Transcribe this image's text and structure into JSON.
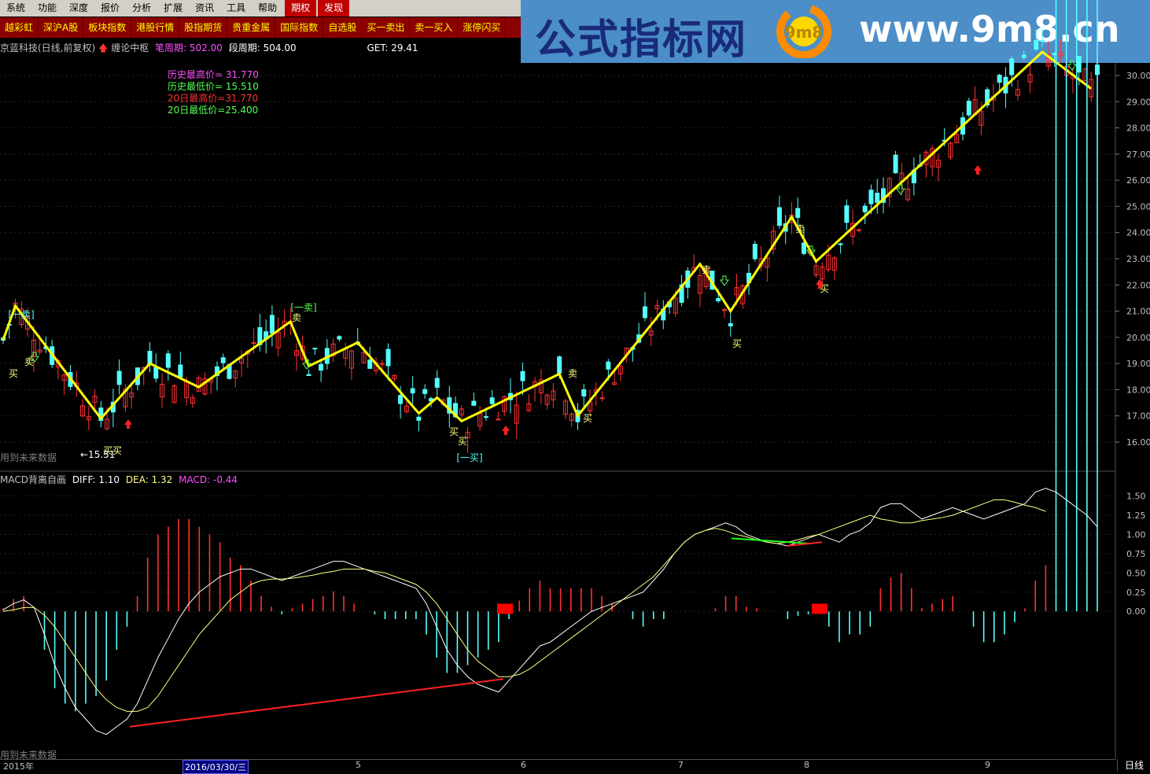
{
  "menubar": {
    "items": [
      "系统",
      "功能",
      "深度",
      "报价",
      "分析",
      "扩展",
      "资讯",
      "工具",
      "帮助"
    ],
    "highlighted": [
      "期权",
      "发现"
    ]
  },
  "quickbar": {
    "items": [
      "越彩虹",
      "深沪A股",
      "板块指数",
      "港股行情",
      "股指期货",
      "贵重金属",
      "国际指数",
      "自选股",
      "买一卖出",
      "卖一买入",
      "涨停闪买"
    ]
  },
  "banner": {
    "title": "公式指标网",
    "url": "www.9m8.cn",
    "logo_text": "9m8"
  },
  "header": {
    "stock": "京蓝科技(日线,前复权)",
    "indicator": "缠论中枢",
    "bi_label": "笔周期:",
    "bi_value": "502.00",
    "duan_label": "段周期:",
    "duan_value": "504.00",
    "get_label": "GET:",
    "get_value": "29.41"
  },
  "stats": {
    "hist_high": "历史最高价= 31.770",
    "hist_low": "历史最低价= 15.510",
    "d20_high": "20日最高价=31.770",
    "d20_low": "20日最低价=25.400"
  },
  "labels": {
    "future_top": "用到未来数据",
    "future_bottom": "用到未来数据",
    "low_mark": "←15.51",
    "buy": "买",
    "sell": "卖",
    "one_buy": "[一买]",
    "one_sell": "[一卖]"
  },
  "macd_header": {
    "name": "MACD背离自画",
    "diff_label": "DIFF:",
    "diff_value": "1.10",
    "dea_label": "DEA:",
    "dea_value": "1.32",
    "macd_label": "MACD:",
    "macd_value": "-0.44"
  },
  "price_axis": [
    "30.00",
    "29.00",
    "28.00",
    "27.00",
    "26.00",
    "25.00",
    "24.00",
    "23.00",
    "22.00",
    "21.00",
    "20.00",
    "19.00",
    "18.00",
    "17.00",
    "16.00"
  ],
  "macd_axis": [
    "1.50",
    "1.25",
    "1.00",
    "0.75",
    "0.50",
    "0.25",
    "0.00"
  ],
  "time_axis": {
    "year": "2015年",
    "cursor_date": "2016/03/30/三",
    "months": [
      "5",
      "6",
      "7",
      "8",
      "9"
    ]
  },
  "period": "日线",
  "colors": {
    "up": "#ff3232",
    "down": "#54ffff",
    "zigzag": "#ffff00",
    "diff": "#ffffff",
    "dea": "#ffff80",
    "macd_text": "#ff50ff"
  },
  "chart_data": {
    "type": "candlestick",
    "price_range": [
      15.5,
      31.8
    ],
    "zigzag": [
      {
        "i": 0,
        "p": 19.9
      },
      {
        "i": 2,
        "p": 21.2
      },
      {
        "i": 16,
        "p": 16.9
      },
      {
        "i": 24,
        "p": 19.0
      },
      {
        "i": 32,
        "p": 18.1
      },
      {
        "i": 47,
        "p": 20.6
      },
      {
        "i": 50,
        "p": 18.9
      },
      {
        "i": 58,
        "p": 19.8
      },
      {
        "i": 68,
        "p": 17.1
      },
      {
        "i": 71,
        "p": 17.7
      },
      {
        "i": 75,
        "p": 16.8
      },
      {
        "i": 91,
        "p": 18.6
      },
      {
        "i": 94,
        "p": 17.0
      },
      {
        "i": 114,
        "p": 22.8
      },
      {
        "i": 119,
        "p": 21.0
      },
      {
        "i": 129,
        "p": 24.6
      },
      {
        "i": 133,
        "p": 22.9
      },
      {
        "i": 170,
        "p": 30.9
      },
      {
        "i": 178,
        "p": 29.5
      }
    ],
    "macd_range": [
      -1.9,
      1.7
    ],
    "macd_ticks": [
      1.5,
      1.25,
      1.0,
      0.75,
      0.5,
      0.25,
      0.0
    ],
    "diff": [
      0.02,
      0.1,
      0.15,
      0.05,
      -0.3,
      -0.7,
      -1.0,
      -1.25,
      -1.4,
      -1.55,
      -1.6,
      -1.5,
      -1.4,
      -1.2,
      -0.9,
      -0.6,
      -0.35,
      -0.1,
      0.1,
      0.25,
      0.35,
      0.45,
      0.5,
      0.55,
      0.55,
      0.5,
      0.45,
      0.4,
      0.45,
      0.5,
      0.55,
      0.6,
      0.65,
      0.65,
      0.6,
      0.55,
      0.5,
      0.45,
      0.4,
      0.35,
      0.3,
      0.1,
      -0.2,
      -0.5,
      -0.7,
      -0.85,
      -0.95,
      -1.0,
      -1.05,
      -0.9,
      -0.75,
      -0.6,
      -0.45,
      -0.4,
      -0.3,
      -0.2,
      -0.1,
      0.0,
      0.05,
      0.1,
      0.15,
      0.2,
      0.25,
      0.4,
      0.55,
      0.75,
      0.9,
      1.0,
      1.05,
      1.1,
      1.15,
      1.1,
      1.0,
      0.95,
      0.9,
      0.88,
      0.85,
      0.9,
      0.95,
      1.0,
      0.95,
      0.9,
      1.0,
      1.05,
      1.15,
      1.35,
      1.4,
      1.4,
      1.3,
      1.2,
      1.25,
      1.3,
      1.35,
      1.3,
      1.25,
      1.2,
      1.25,
      1.3,
      1.35,
      1.4,
      1.55,
      1.6,
      1.55,
      1.45,
      1.35,
      1.25,
      1.1
    ],
    "dea": [
      0.0,
      0.02,
      0.05,
      0.05,
      -0.05,
      -0.2,
      -0.4,
      -0.6,
      -0.8,
      -1.0,
      -1.15,
      -1.25,
      -1.3,
      -1.3,
      -1.25,
      -1.1,
      -0.9,
      -0.7,
      -0.5,
      -0.3,
      -0.15,
      0.0,
      0.15,
      0.25,
      0.35,
      0.4,
      0.42,
      0.42,
      0.43,
      0.45,
      0.47,
      0.5,
      0.52,
      0.55,
      0.55,
      0.55,
      0.52,
      0.5,
      0.45,
      0.4,
      0.35,
      0.25,
      0.1,
      -0.1,
      -0.3,
      -0.5,
      -0.65,
      -0.75,
      -0.85,
      -0.85,
      -0.82,
      -0.75,
      -0.65,
      -0.55,
      -0.45,
      -0.35,
      -0.25,
      -0.15,
      -0.05,
      0.05,
      0.15,
      0.25,
      0.35,
      0.45,
      0.6,
      0.75,
      0.9,
      1.0,
      1.05,
      1.08,
      1.05,
      1.0,
      0.97,
      0.93,
      0.9,
      0.88,
      0.9,
      0.93,
      0.97,
      1.0,
      1.05,
      1.1,
      1.15,
      1.2,
      1.25,
      1.2,
      1.18,
      1.15,
      1.15,
      1.18,
      1.2,
      1.22,
      1.25,
      1.3,
      1.35,
      1.4,
      1.45,
      1.45,
      1.42,
      1.38,
      1.35,
      1.3
    ]
  }
}
